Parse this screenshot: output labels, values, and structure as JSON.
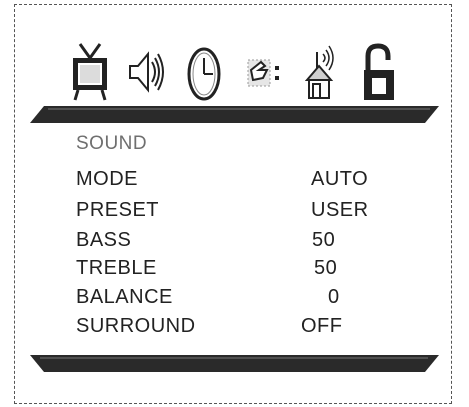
{
  "icons": [
    {
      "name": "tv-picture-icon"
    },
    {
      "name": "speaker-sound-icon"
    },
    {
      "name": "clock-time-icon"
    },
    {
      "name": "hand-setup-icon"
    },
    {
      "name": "house-antenna-icon"
    },
    {
      "name": "padlock-lock-icon"
    }
  ],
  "menu": {
    "title": "SOUND",
    "rows": [
      {
        "label": "MODE",
        "value": "AUTO"
      },
      {
        "label": "PRESET",
        "value": "USER"
      },
      {
        "label": "BASS",
        "value": "50"
      },
      {
        "label": "TREBLE",
        "value": "50"
      },
      {
        "label": "BALANCE",
        "value": "0"
      },
      {
        "label": "SURROUND",
        "value": "OFF"
      }
    ]
  }
}
